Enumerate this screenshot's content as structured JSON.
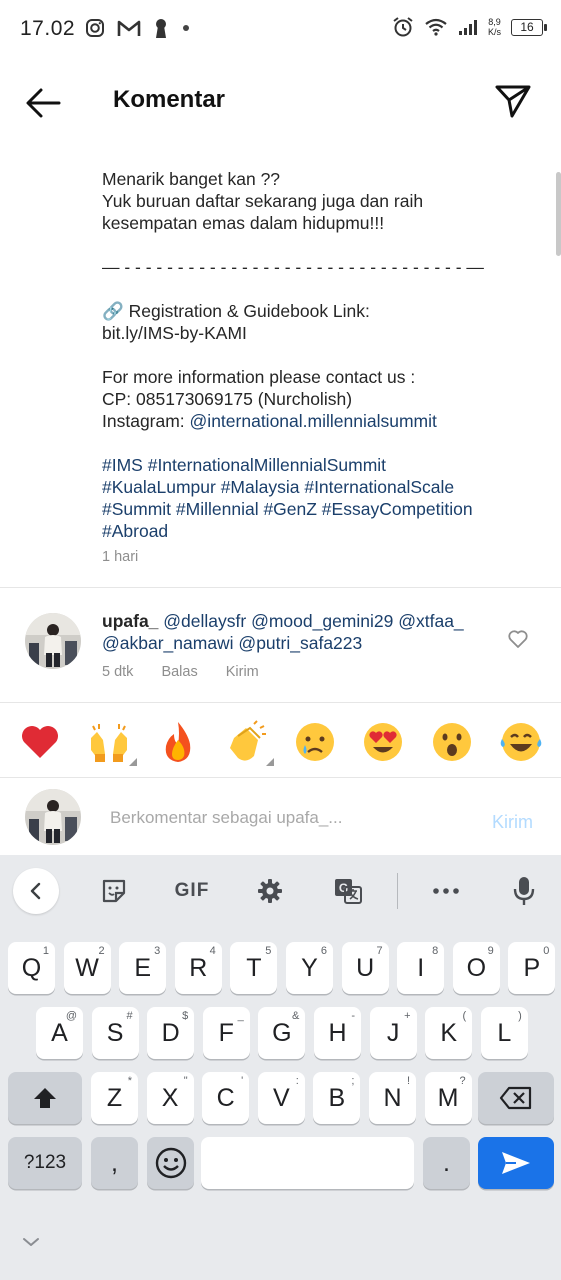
{
  "status_bar": {
    "time": "17.02",
    "net_speed_value": "8,9",
    "net_speed_unit": "K/s",
    "battery": "16"
  },
  "header": {
    "title": "Komentar"
  },
  "caption": {
    "lines": [
      "Menarik banget kan ??",
      "Yuk buruan daftar sekarang juga dan raih",
      "kesempatan emas dalam hidupmu!!!",
      "",
      "— - - - - - - - - - - - - - - - - - - - - - - - - - - - - - - - - —",
      "",
      "🔗 Registration & Guidebook Link:",
      "bit.ly/IMS-by-KAMI",
      "",
      "For more information please contact us :",
      "CP: 085173069175 (Nurcholish)"
    ],
    "instagram_prefix": "Instagram: ",
    "instagram_handle": "@international.millennialsummit",
    "hashtag_lines": [
      "#IMS #InternationalMillennialSummit",
      "#KualaLumpur #Malaysia #InternationalScale",
      "#Summit #Millennial #GenZ #EssayCompetition",
      "#Abroad"
    ],
    "time": "1 hari"
  },
  "comment": {
    "username": "upafa_",
    "mentions_line1": "@dellaysfr @mood_gemini29 @xtfaa_",
    "mentions_line2": "@akbar_namawi @putri_safa223",
    "time": "5 dtk",
    "reply_label": "Balas",
    "send_label": "Kirim"
  },
  "emoji_bar": [
    {
      "emoji": "❤️",
      "name": "heart"
    },
    {
      "emoji": "🙌",
      "name": "raising-hands"
    },
    {
      "emoji": "🔥",
      "name": "fire"
    },
    {
      "emoji": "👏",
      "name": "clapping-hands"
    },
    {
      "emoji": "😢",
      "name": "crying-face"
    },
    {
      "emoji": "😍",
      "name": "heart-eyes"
    },
    {
      "emoji": "😮",
      "name": "open-mouth"
    },
    {
      "emoji": "😂",
      "name": "tears-of-joy"
    }
  ],
  "comment_input": {
    "placeholder": "Berkomentar sebagai upafa_...",
    "post_label": "Kirim"
  },
  "keyboard": {
    "toolbar_gif": "GIF",
    "row1": [
      [
        "Q",
        "1"
      ],
      [
        "W",
        "2"
      ],
      [
        "E",
        "3"
      ],
      [
        "R",
        "4"
      ],
      [
        "T",
        "5"
      ],
      [
        "Y",
        "6"
      ],
      [
        "U",
        "7"
      ],
      [
        "I",
        "8"
      ],
      [
        "O",
        "9"
      ],
      [
        "P",
        "0"
      ]
    ],
    "row2": [
      [
        "A",
        "@"
      ],
      [
        "S",
        "#"
      ],
      [
        "D",
        "$"
      ],
      [
        "F",
        "_"
      ],
      [
        "G",
        "&"
      ],
      [
        "H",
        "-"
      ],
      [
        "J",
        "+"
      ],
      [
        "K",
        "("
      ],
      [
        "L",
        ")"
      ]
    ],
    "row3": [
      [
        "Z",
        "*"
      ],
      [
        "X",
        "\""
      ],
      [
        "C",
        "'"
      ],
      [
        "V",
        ":"
      ],
      [
        "B",
        ";"
      ],
      [
        "N",
        "!"
      ],
      [
        "M",
        "?"
      ]
    ],
    "symbols_label": "?123",
    "comma_label": ",",
    "period_label": "."
  },
  "colors": {
    "link": "#1b3f6b",
    "post_disabled": "#b3dbff",
    "keyboard_bg": "#e8eaed",
    "enter_key": "#1a73e8"
  }
}
